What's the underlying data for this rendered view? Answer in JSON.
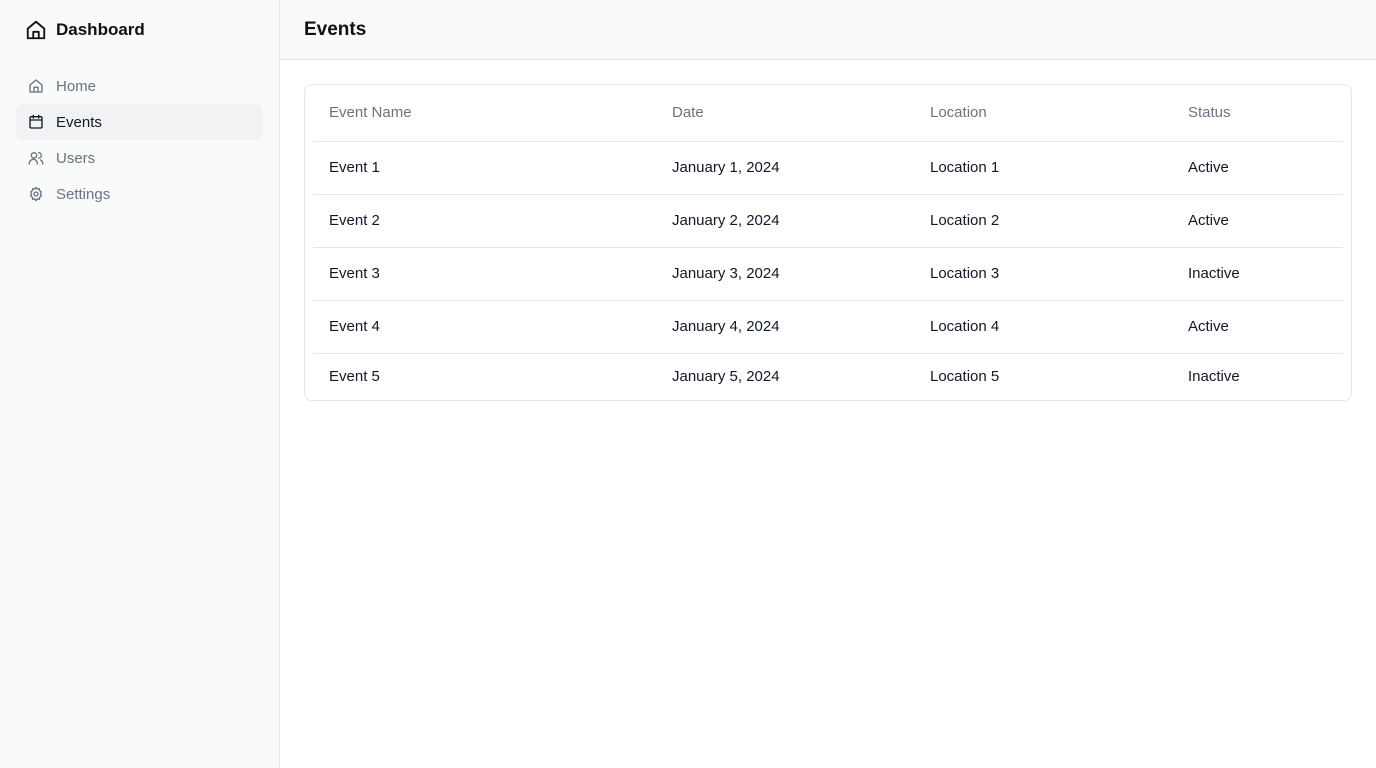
{
  "sidebar": {
    "brand": {
      "title": "Dashboard",
      "icon": "home-icon"
    },
    "items": [
      {
        "label": "Home",
        "icon": "home-icon",
        "active": false
      },
      {
        "label": "Events",
        "icon": "calendar-icon",
        "active": true
      },
      {
        "label": "Users",
        "icon": "users-icon",
        "active": false
      },
      {
        "label": "Settings",
        "icon": "gear-icon",
        "active": false
      }
    ]
  },
  "header": {
    "title": "Events"
  },
  "table": {
    "columns": [
      "Event Name",
      "Date",
      "Location",
      "Status"
    ],
    "rows": [
      [
        "Event 1",
        "January 1, 2024",
        "Location 1",
        "Active"
      ],
      [
        "Event 2",
        "January 2, 2024",
        "Location 2",
        "Active"
      ],
      [
        "Event 3",
        "January 3, 2024",
        "Location 3",
        "Inactive"
      ],
      [
        "Event 4",
        "January 4, 2024",
        "Location 4",
        "Active"
      ],
      [
        "Event 5",
        "January 5, 2024",
        "Location 5",
        "Inactive"
      ]
    ]
  },
  "colors": {
    "sidebar_bg": "#f9fafa",
    "active_bg": "#f1f2f4",
    "muted_text": "#6b7280",
    "border": "#e5e7eb"
  }
}
